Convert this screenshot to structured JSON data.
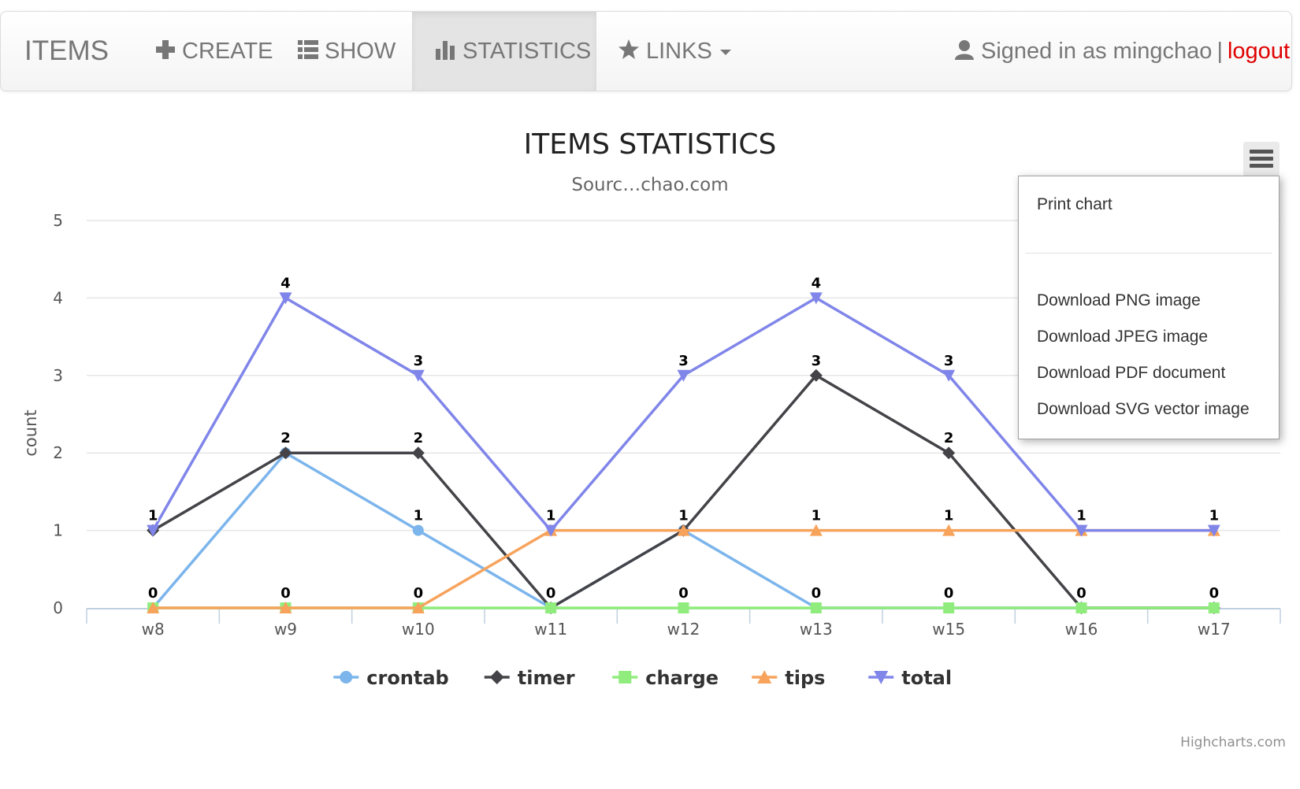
{
  "nav": {
    "brand": "ITEMS",
    "items": [
      {
        "label": "CREATE",
        "icon": "plus-icon",
        "active": false
      },
      {
        "label": "SHOW",
        "icon": "list-icon",
        "active": false
      },
      {
        "label": "STATISTICS",
        "icon": "bar-chart-icon",
        "active": true
      },
      {
        "label": "LINKS",
        "icon": "star-icon",
        "active": false
      }
    ],
    "signed_in_text": "Signed in as mingchao",
    "separator": "|",
    "logout_label": "logout",
    "user_icon": "user-icon"
  },
  "export_menu": {
    "items": [
      "Print chart",
      "Download PNG image",
      "Download JPEG image",
      "Download PDF document",
      "Download SVG vector image"
    ]
  },
  "chart_data": {
    "type": "line",
    "title": "ITEMS STATISTICS",
    "subtitle": "Sourc…chao.com",
    "ylabel": "count",
    "xlabel": "",
    "ylim": [
      0,
      5
    ],
    "yticks": [
      0,
      1,
      2,
      3,
      4,
      5
    ],
    "categories": [
      "w8",
      "w9",
      "w10",
      "w11",
      "w12",
      "w13",
      "w15",
      "w16",
      "w17"
    ],
    "grid": true,
    "legend_position": "bottom-center",
    "credits": "Highcharts.com",
    "series": [
      {
        "name": "crontab",
        "color": "#7cb5ec",
        "marker": "circle",
        "values": [
          0,
          2,
          1,
          0,
          1,
          0,
          0,
          0,
          0
        ]
      },
      {
        "name": "timer",
        "color": "#434348",
        "marker": "diamond",
        "values": [
          1,
          2,
          2,
          0,
          1,
          3,
          2,
          0,
          0
        ]
      },
      {
        "name": "charge",
        "color": "#90ed7d",
        "marker": "square",
        "values": [
          0,
          0,
          0,
          0,
          0,
          0,
          0,
          0,
          0
        ]
      },
      {
        "name": "tips",
        "color": "#f7a35c",
        "marker": "triangle",
        "values": [
          0,
          0,
          0,
          1,
          1,
          1,
          1,
          1,
          1
        ]
      },
      {
        "name": "total",
        "color": "#8085e9",
        "marker": "triangle-down",
        "values": [
          1,
          4,
          3,
          1,
          3,
          4,
          3,
          1,
          1
        ]
      }
    ],
    "data_labels": [
      {
        "category": "w8",
        "labels": [
          "1",
          "0"
        ]
      },
      {
        "category": "w9",
        "labels": [
          "4",
          "2",
          "0"
        ]
      },
      {
        "category": "w10",
        "labels": [
          "3",
          "2",
          "1",
          "0"
        ]
      },
      {
        "category": "w11",
        "labels": [
          "1",
          "0"
        ]
      },
      {
        "category": "w12",
        "labels": [
          "3",
          "1",
          "0"
        ]
      },
      {
        "category": "w13",
        "labels": [
          "4",
          "3",
          "1",
          "0"
        ]
      },
      {
        "category": "w15",
        "labels": [
          "3",
          "2",
          "1",
          "0"
        ]
      },
      {
        "category": "w16",
        "labels": [
          "1",
          "0"
        ]
      },
      {
        "category": "w17",
        "labels": [
          "1",
          "0"
        ]
      }
    ]
  }
}
